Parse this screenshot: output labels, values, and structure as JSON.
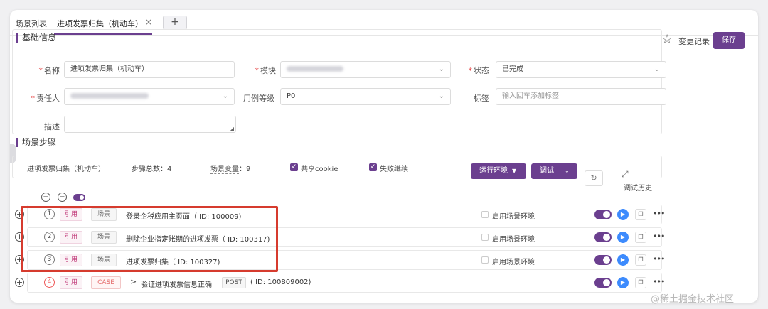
{
  "tabs": {
    "list": "场景列表",
    "active": "进项发票归集（机动车）",
    "close": "×",
    "add": "+"
  },
  "sections": {
    "base": "基础信息",
    "steps": "场景步骤"
  },
  "form": {
    "name_label": "名称",
    "name_value": "进项发票归集（机动车）",
    "module_label": "模块",
    "status_label": "状态",
    "status_value": "已完成",
    "owner_label": "责任人",
    "level_label": "用例等级",
    "level_value": "P0",
    "tags_label": "标签",
    "tags_placeholder": "输入回车添加标签",
    "desc_label": "描述",
    "required_mark": "*"
  },
  "header_actions": {
    "changelog": "变更记录",
    "save": "保存"
  },
  "steps_bar": {
    "scene_name": "进项发票归集（机动车）",
    "total_steps": "步骤总数：4",
    "vars_label": "场景变量",
    "vars_count": "：9",
    "share_cookie": "共享cookie",
    "fail_continue": "失败继续",
    "run_env": "运行环境",
    "debug": "调试",
    "debug_history": "调试历史"
  },
  "rows": [
    {
      "num": "1",
      "ref": "引用",
      "type": "场景",
      "text": "登录企税应用主页面（ ID: 100009)",
      "env": "启用场景环境"
    },
    {
      "num": "2",
      "ref": "引用",
      "type": "场景",
      "text": "删除企业指定账期的进项发票（ ID: 100317)",
      "env": "启用场景环境"
    },
    {
      "num": "3",
      "ref": "引用",
      "type": "场景",
      "text": "进项发票归集（ ID: 100327)",
      "env": "启用场景环境"
    },
    {
      "num": "4",
      "ref": "引用",
      "type": "CASE",
      "arrow": ">",
      "text": "验证进项发票信息正确",
      "method": "POST",
      "id": "( ID: 100809002)"
    }
  ],
  "watermark": "@稀土掘金技术社区",
  "colors": {
    "accent": "#6b3f8f",
    "highlight": "#d63b2e",
    "play": "#3d8bfd"
  }
}
